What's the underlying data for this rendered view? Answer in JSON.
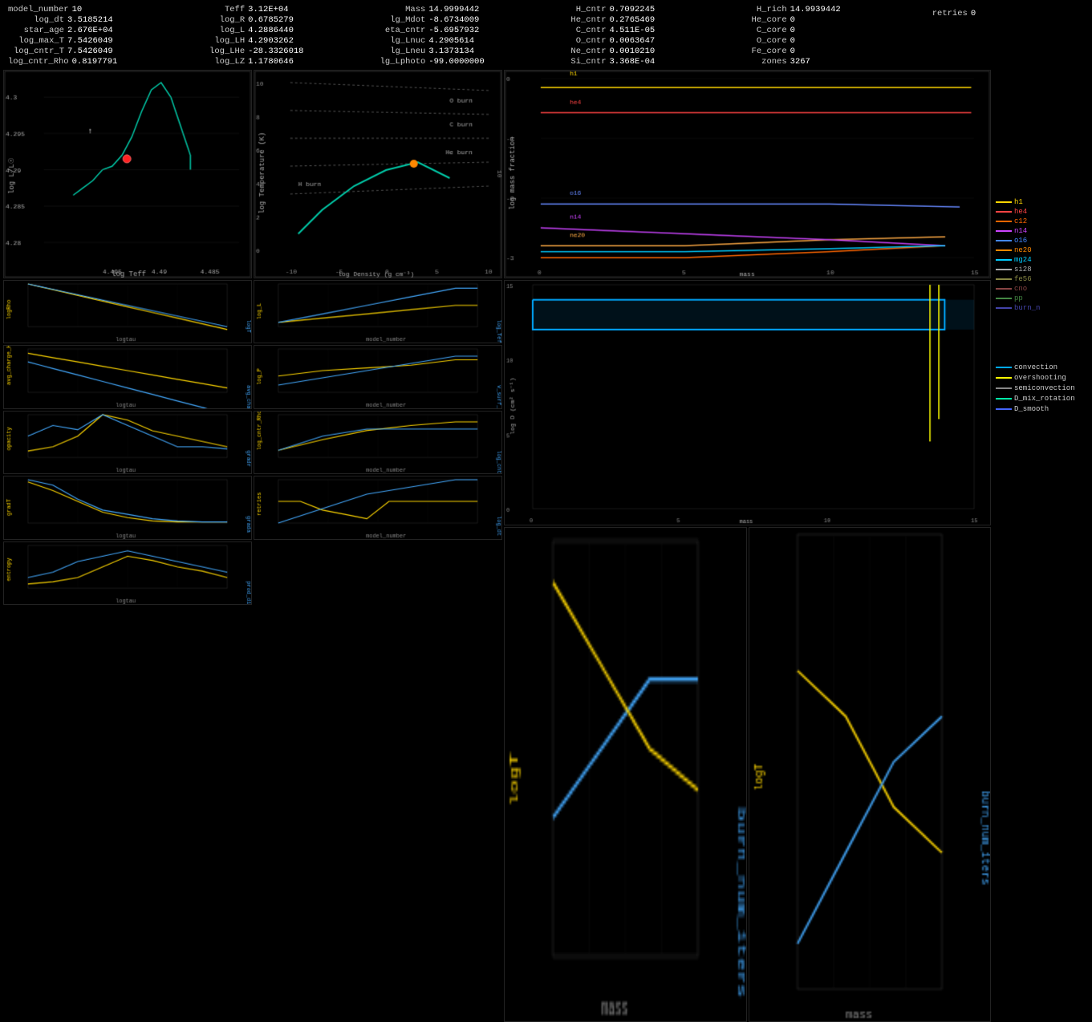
{
  "header": {
    "fields": [
      [
        {
          "label": "model_number",
          "value": "10"
        },
        {
          "label": "log_dt",
          "value": "3.5185214"
        },
        {
          "label": "star_age",
          "value": "2.676E+04"
        },
        {
          "label": "log_max_T",
          "value": "7.5426049"
        },
        {
          "label": "log_cntr_T",
          "value": "7.5426049"
        },
        {
          "label": "log_cntr_Rho",
          "value": "0.8197791"
        }
      ],
      [
        {
          "label": "Teff",
          "value": "3.12E+04"
        },
        {
          "label": "log_R",
          "value": "0.6785279"
        },
        {
          "label": "log_L",
          "value": "4.2886440"
        },
        {
          "label": "log_LH",
          "value": "4.2903262"
        },
        {
          "label": "log_LHe",
          "value": "-28.3326018"
        },
        {
          "label": "log_LZ",
          "value": "1.1780646"
        }
      ],
      [
        {
          "label": "Mass",
          "value": "14.9999442"
        },
        {
          "label": "lg_Mdot",
          "value": "-8.6734009"
        },
        {
          "label": "eta_cntr",
          "value": "-5.6957932"
        },
        {
          "label": "lg_Lnuc",
          "value": "4.2905614"
        },
        {
          "label": "lg_Lneu",
          "value": "3.1373134"
        },
        {
          "label": "lg_Lphoto",
          "value": "-99.0000000"
        }
      ],
      [
        {
          "label": "H_cntr",
          "value": "0.7092245"
        },
        {
          "label": "He_cntr",
          "value": "0.2765469"
        },
        {
          "label": "C_cntr",
          "value": "4.511E-05"
        },
        {
          "label": "O_cntr",
          "value": "0.0063647"
        },
        {
          "label": "Ne_cntr",
          "value": "0.0010210"
        },
        {
          "label": "Si_cntr",
          "value": "3.368E-04"
        }
      ],
      [
        {
          "label": "H_rich",
          "value": "14.9939442"
        },
        {
          "label": "He_core",
          "value": "0"
        },
        {
          "label": "C_core",
          "value": "0"
        },
        {
          "label": "O_core",
          "value": "0"
        },
        {
          "label": "Fe_core",
          "value": "0"
        },
        {
          "label": "zones",
          "value": "3267"
        }
      ],
      [
        {
          "label": "",
          "value": ""
        },
        {
          "label": "",
          "value": ""
        },
        {
          "label": "",
          "value": ""
        },
        {
          "label": "",
          "value": ""
        },
        {
          "label": "",
          "value": ""
        },
        {
          "label": "retries",
          "value": "0"
        }
      ]
    ]
  },
  "legend": {
    "species": [
      {
        "label": "h1",
        "color": "#FFD700"
      },
      {
        "label": "he4",
        "color": "#FF4444"
      },
      {
        "label": "c12",
        "color": "#FF6600"
      },
      {
        "label": "n14",
        "color": "#CC44FF"
      },
      {
        "label": "o16",
        "color": "#4488FF"
      },
      {
        "label": "ne20",
        "color": "#FF8800"
      },
      {
        "label": "mg24",
        "color": "#00CCFF"
      },
      {
        "label": "si28",
        "color": "#AAAAAA"
      },
      {
        "label": "fe56",
        "color": "#888844"
      },
      {
        "label": "",
        "color": ""
      },
      {
        "label": "cno",
        "color": "#884444"
      },
      {
        "label": "pp",
        "color": "#448844"
      },
      {
        "label": "burn_n",
        "color": "#4444AA"
      }
    ],
    "mixing": [
      {
        "label": "convection",
        "color": "#00AAFF"
      },
      {
        "label": "overshooting",
        "color": "#FFFF00"
      },
      {
        "label": "semiconvection",
        "color": "#888888"
      },
      {
        "label": "D_mix_rotation",
        "color": "#00FFAA"
      },
      {
        "label": "D_smooth",
        "color": "#4466FF"
      }
    ]
  }
}
